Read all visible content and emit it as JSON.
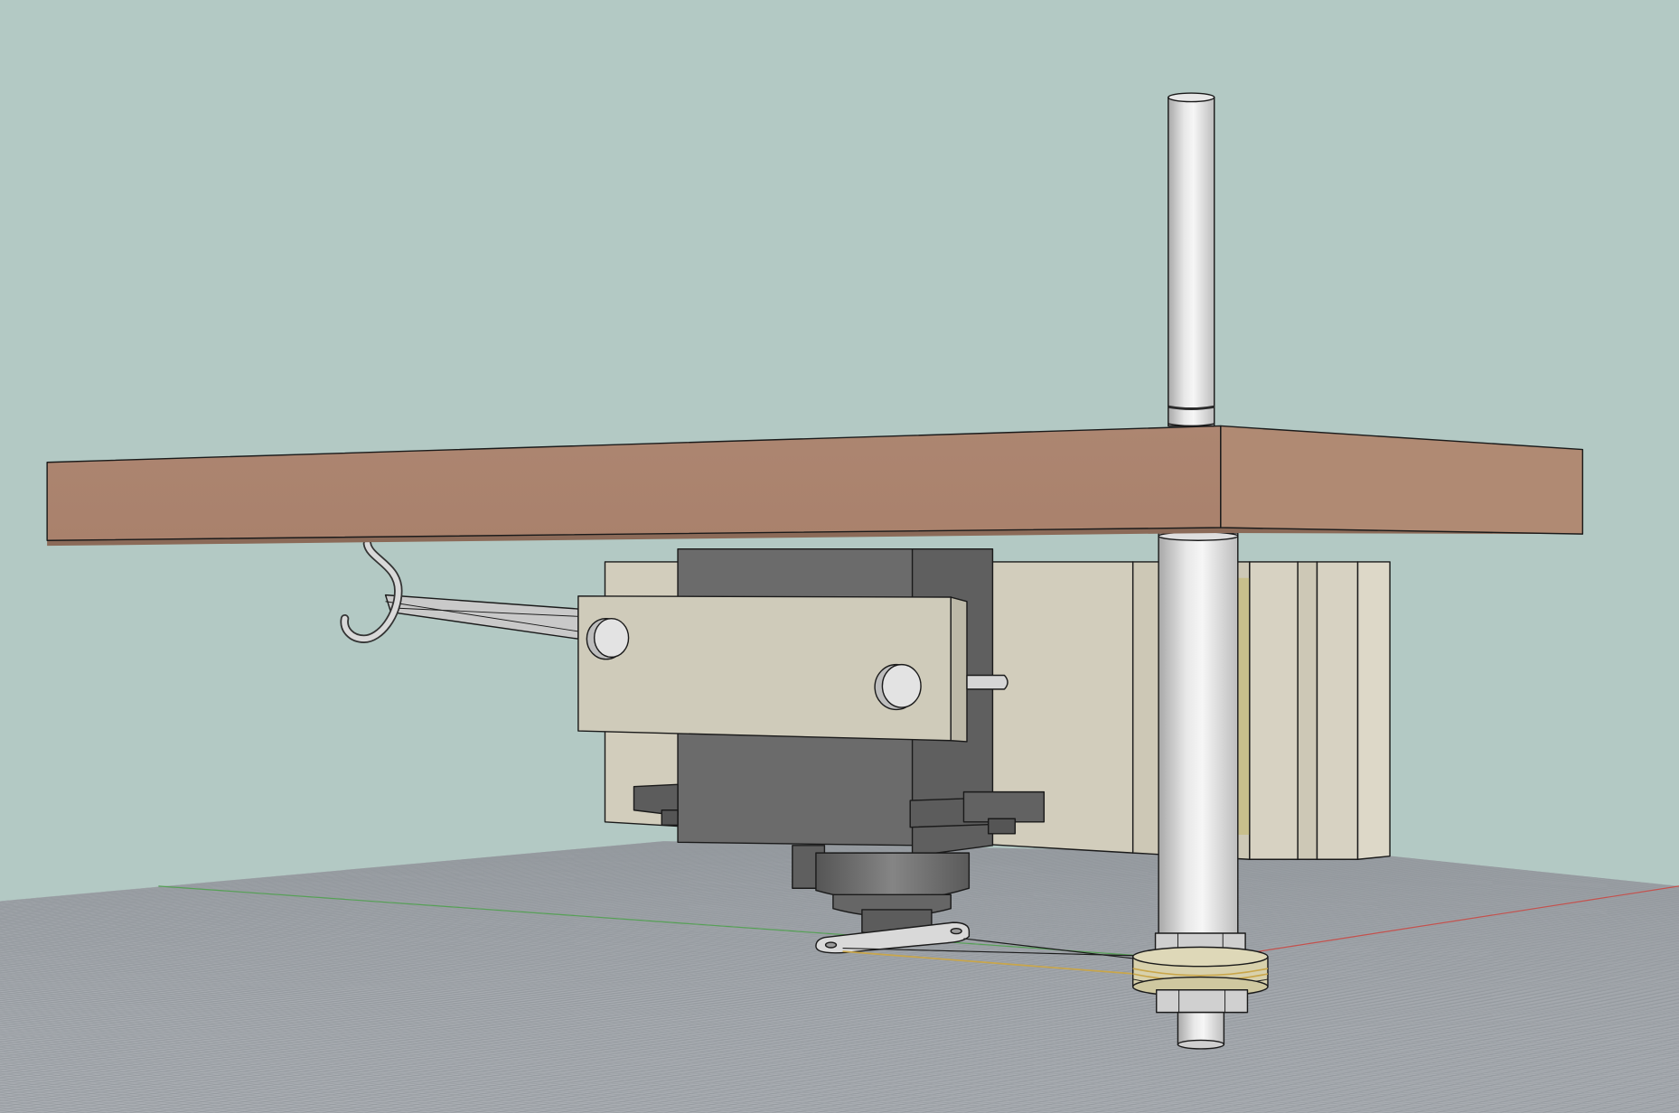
{
  "viewport": {
    "background_color": "#b3c9c4",
    "ground_color": "#a9adb2",
    "grid_line_color": "#8d9298",
    "x_axis_color": "#c4504c",
    "y_axis_color": "#55a055"
  },
  "materials": {
    "board_front_color": "#a9816c",
    "board_side_color": "#b08a73",
    "board_bottom_color": "#8b6a58",
    "servo_color": "#6b6b6b",
    "servo_side_color": "#5f5f5f",
    "servo_tab_color": "#5c5c5c",
    "plate_color": "#d2cdbc",
    "slat_color": "#d7d2c2",
    "slat_shade_color": "#cdc8b6",
    "slat_accent_color": "#c8bf8c",
    "arm_color": "#cfcbba",
    "arm_edge_color": "#bdb9a8",
    "metal_color": "#d9d9d9",
    "metal_shade_color": "#bdbdbd",
    "pulley_color": "#d8d1ac",
    "string_color": "#c9a64a",
    "line_color": "#1a1a1a"
  }
}
